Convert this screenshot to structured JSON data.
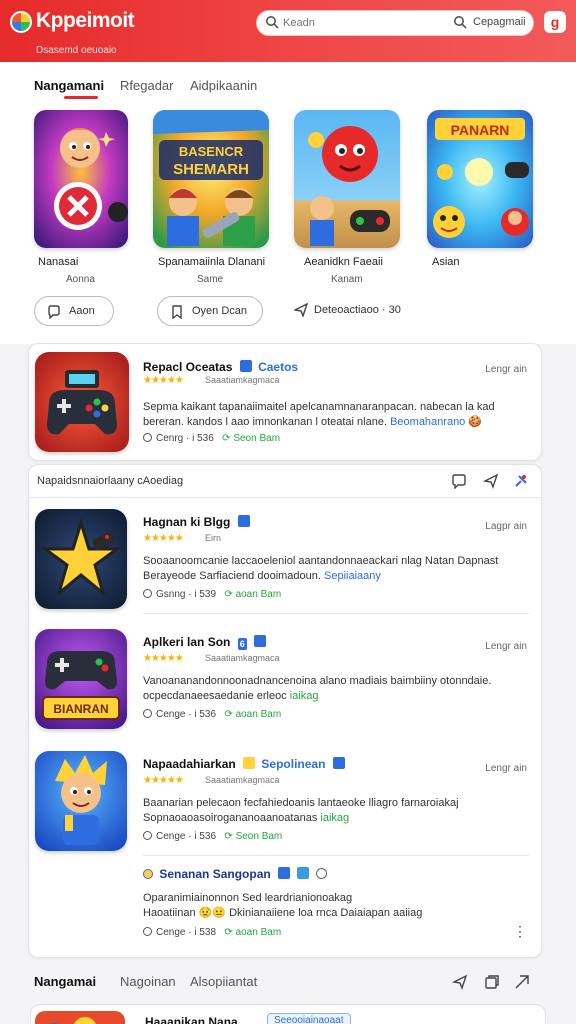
{
  "app": {
    "title": "Kppeimoit",
    "subtitle": "Dsasemd oeuoaio",
    "brand_color": "#e62a2a"
  },
  "search": {
    "placeholder": "Keadn",
    "button_label": "Cepagmaii"
  },
  "header_badge": "g",
  "tabs_top": [
    {
      "label": "Nangamani",
      "active": true
    },
    {
      "label": "Rfegadar",
      "active": false
    },
    {
      "label": "Aidpikaanin",
      "active": false
    }
  ],
  "featured": [
    {
      "name": "Nanasai",
      "sub": "Aonna",
      "icon": "magic-game-art"
    },
    {
      "name": "Spanamaiinla Dlanani",
      "sub": "Same",
      "icon": "strategy-game-art",
      "art_text": "BASENCR SHEMARH"
    },
    {
      "name": "Aeanidkn Faeaii",
      "sub": "Kanam",
      "icon": "action-game-art"
    },
    {
      "name": "Asian",
      "sub": "",
      "icon": "party-game-art",
      "art_text": "PANARN"
    }
  ],
  "featured_actions": [
    {
      "label": "Aaon",
      "icon": "chat-icon"
    },
    {
      "label": "Oyen Dcan",
      "icon": "bookmark-icon"
    },
    {
      "label": "Deteoactiaoo · 30",
      "icon": "send-icon"
    }
  ],
  "featured_app": {
    "title": "Repacl Oceatas",
    "tag": "Caetos",
    "time": "Lengr ain",
    "rating_text": "Saaatiamkagmaca",
    "desc_1": "Sepma kaikant tapanaiimaitel apelcanamnanaranpacan. nabecan la kad",
    "desc_2": "bereran. kandos l aao imnonkanan l oteatai nlane.",
    "desc_link": "Beomahanrano",
    "meta_left": "Cenrg · i 536",
    "meta_right": "Seon Bam"
  },
  "feed_header": {
    "label": "Napaidsnnaiorlaany cAoediag"
  },
  "feed": [
    {
      "title": "Hagnan ki Blgg",
      "time": "Lagpr ain",
      "rating_text": "Eirn",
      "desc_1": "Sooaanoomcanie laccaoeleniol aantandonnaeackari nlag Natan Dapnast",
      "desc_2": "Berayeode Sarfiaciend dooimadoun.",
      "desc_link": "Sepiiaiaany",
      "meta_left": "Gsnng · i 539",
      "meta_right": "aoan Bam",
      "icon": "star-game-art"
    },
    {
      "title": "Aplkeri lan Son",
      "tag": "6",
      "time": "Lengr ain",
      "rating_text": "Saaatiamkagmaca",
      "desc_1": "Vanoananandonnoonadnancenoina alano madiais baimbiiny otonndaie.",
      "desc_2": "ocpecdanaeesaedanie erleoc",
      "desc_link": "iaikag",
      "meta_left": "Cenge · i 536",
      "meta_right": "aoan Bam",
      "icon": "controller-game-art",
      "art_text": "BIANRAN"
    },
    {
      "title": "Napaadahiarkan",
      "tag": "Sepolinean",
      "time": "Lengr ain",
      "rating_text": "Saaatiamkagmaca",
      "desc_1": "Baanarian pelecaon fecfahiedoanis lantaeoke lliagro farnaroiakaj",
      "desc_2": "Sopnaoaoasoirogananoaanoatanas",
      "desc_link": "iaikag",
      "meta_left": "Cenge · i 536",
      "meta_right": "Seon Bam",
      "icon": "hero-game-art"
    }
  ],
  "comment": {
    "title": "Senanan Sangopan",
    "line_1": "Oparanimiainonnon Sed leardrianionoakag",
    "line_2": "Haoatiinan",
    "line_2b": "Dkinianaiiene loa rnca Daiaiapan aaiiag",
    "meta_left": "Cenge · i 538",
    "meta_right": "aoan Bam"
  },
  "tabs_bottom": [
    {
      "label": "Nangamai",
      "active": true
    },
    {
      "label": "Nagoinan",
      "active": false
    },
    {
      "label": "Alsopiiantat",
      "active": false
    }
  ],
  "bottom_item": {
    "title": "Haaanikan Nana",
    "chip": "Seeooiainaoaat"
  }
}
